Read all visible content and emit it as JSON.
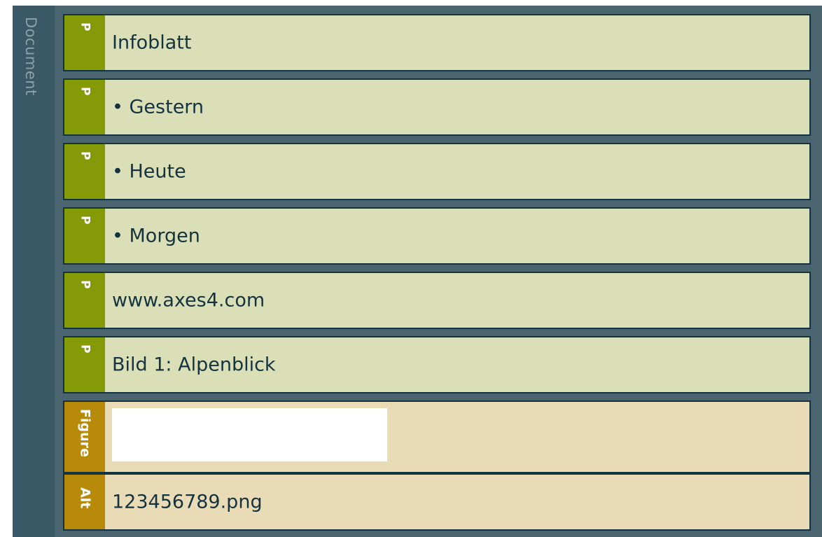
{
  "document": {
    "label": "Document"
  },
  "rows": [
    {
      "tag": "P",
      "text": "Infoblatt"
    },
    {
      "tag": "P",
      "text": "• Gestern"
    },
    {
      "tag": "P",
      "text": "• Heute"
    },
    {
      "tag": "P",
      "text": "• Morgen"
    },
    {
      "tag": "P",
      "text": "www.axes4.com"
    },
    {
      "tag": "P",
      "text": "Bild 1: Alpenblick"
    }
  ],
  "figure": {
    "tag": "Figure"
  },
  "alt": {
    "tag": "Alt",
    "text": "123456789.png"
  },
  "colors": {
    "p_tag": "#849a07",
    "figure_tag": "#b78a09",
    "p_row_bg": "#dbdfb7",
    "figure_row_bg": "#e9dbb6",
    "frame": "#4a6470",
    "text": "#14333f"
  }
}
